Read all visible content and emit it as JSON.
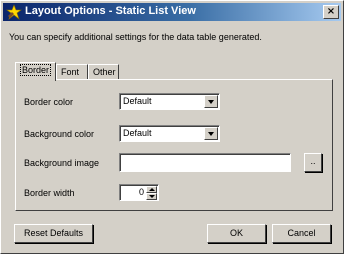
{
  "window": {
    "title": "Layout Options - Static List View",
    "close_label": "×",
    "title_icon": "star-icon"
  },
  "description": "You can specify additional settings for the data table generated.",
  "tabs": [
    {
      "label": "Border",
      "active": true
    },
    {
      "label": "Font",
      "active": false
    },
    {
      "label": "Other",
      "active": false
    }
  ],
  "border_tab": {
    "border_color": {
      "label": "Border color",
      "value": "Default"
    },
    "background_color": {
      "label": "Background color",
      "value": "Default"
    },
    "background_image": {
      "label": "Background image",
      "value": "",
      "browse_label": ".."
    },
    "border_width": {
      "label": "Border width",
      "value": "0"
    }
  },
  "buttons": {
    "reset_defaults": "Reset Defaults",
    "ok": "OK",
    "cancel": "Cancel"
  }
}
